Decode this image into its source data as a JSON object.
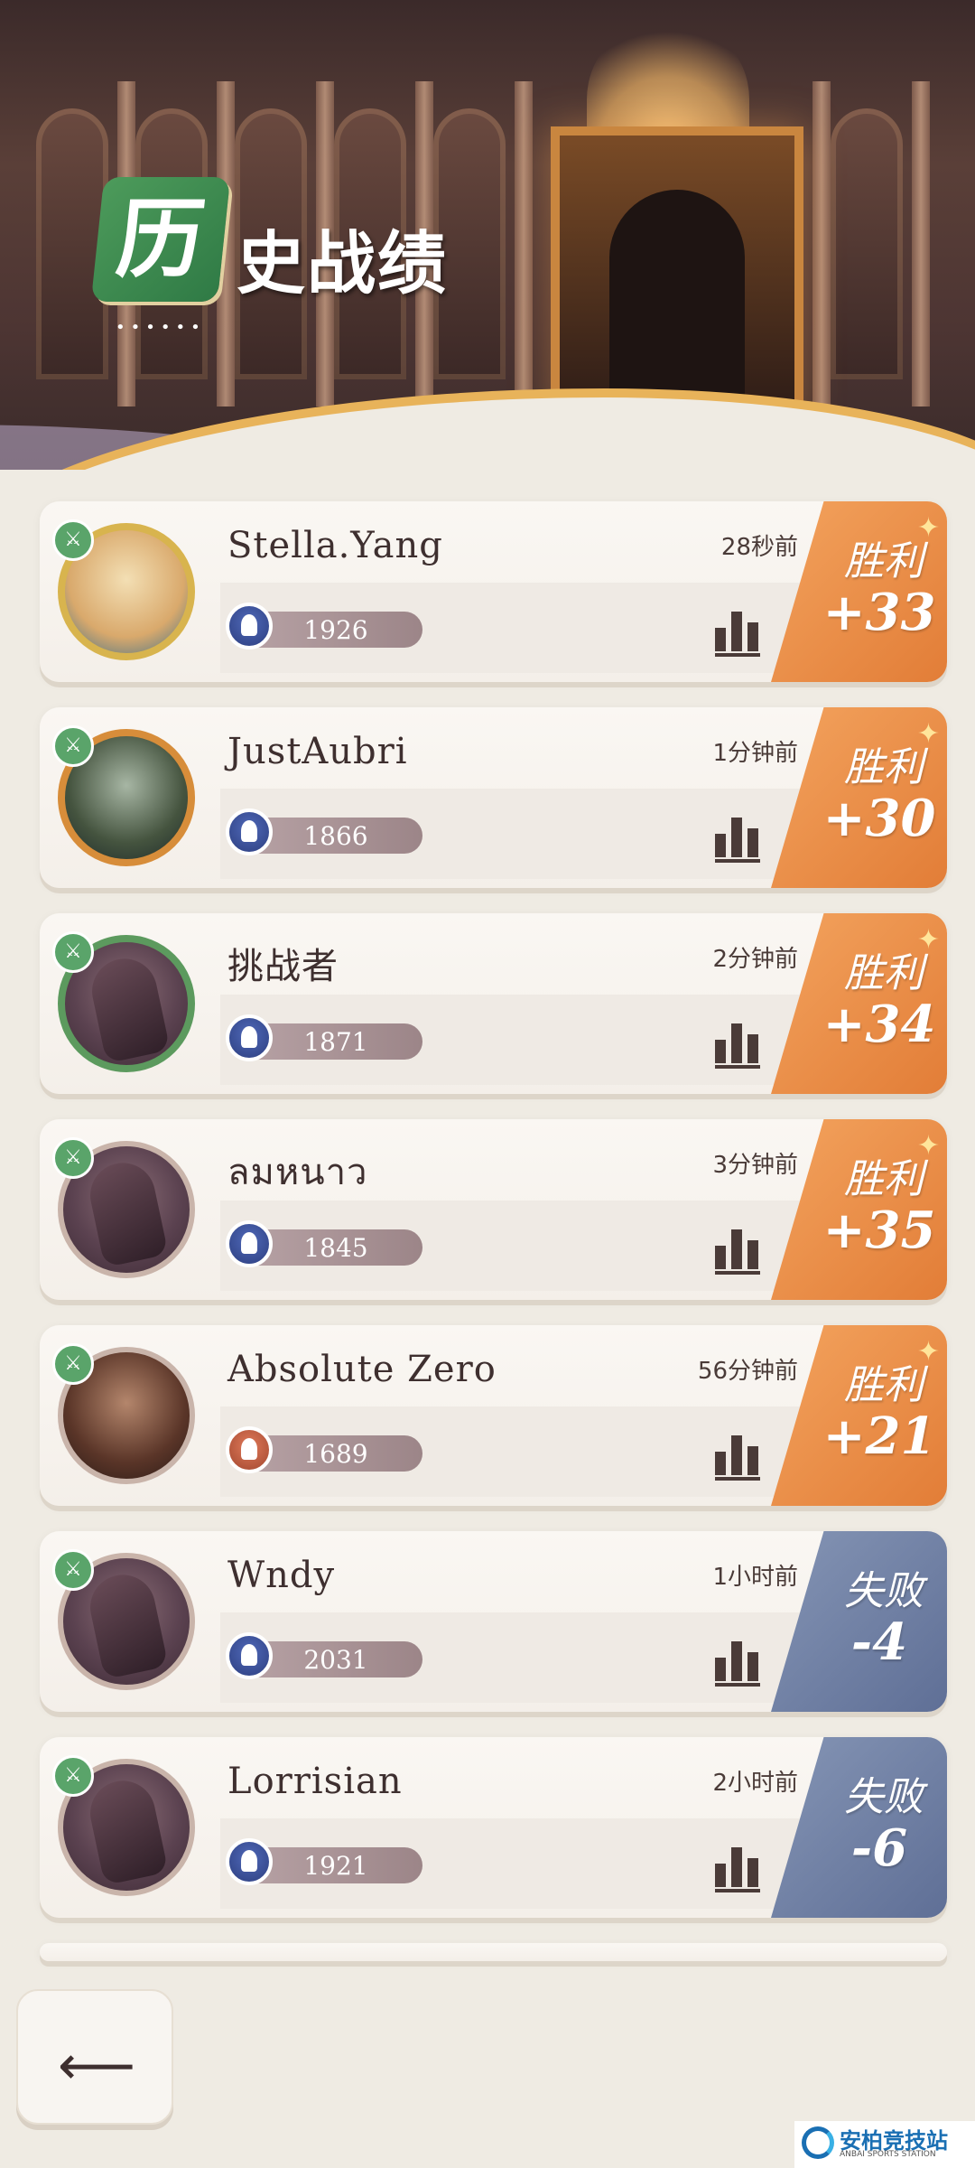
{
  "header": {
    "title_first_char": "历",
    "title_rest": "史战绩",
    "dots": "••••••"
  },
  "matches": [
    {
      "name": "Stella.Yang",
      "time": "28秒前",
      "score": "1926",
      "result": "胜利",
      "delta": "+33",
      "outcome": "win",
      "avatar": "gold",
      "emblem": "blue"
    },
    {
      "name": "JustAubri",
      "time": "1分钟前",
      "score": "1866",
      "result": "胜利",
      "delta": "+30",
      "outcome": "win",
      "avatar": "orange",
      "emblem": "blue"
    },
    {
      "name": "挑战者",
      "time": "2分钟前",
      "score": "1871",
      "result": "胜利",
      "delta": "+34",
      "outcome": "win",
      "avatar": "vine",
      "emblem": "blue"
    },
    {
      "name": "ลมหนาว",
      "time": "3分钟前",
      "score": "1845",
      "result": "胜利",
      "delta": "+35",
      "outcome": "win",
      "avatar": "hood",
      "emblem": "blue"
    },
    {
      "name": "Absolute Zero",
      "time": "56分钟前",
      "score": "1689",
      "result": "胜利",
      "delta": "+21",
      "outcome": "win",
      "avatar": "dark",
      "emblem": "red"
    },
    {
      "name": "Wndy",
      "time": "1小时前",
      "score": "2031",
      "result": "失败",
      "delta": "-4",
      "outcome": "loss",
      "avatar": "hood",
      "emblem": "blue"
    },
    {
      "name": "Lorrisian",
      "time": "2小时前",
      "score": "1921",
      "result": "失败",
      "delta": "-6",
      "outcome": "loss",
      "avatar": "hood",
      "emblem": "blue"
    }
  ],
  "back_button": {
    "icon": "back-arrow-icon",
    "glyph": "⟵"
  },
  "watermark": {
    "title": "安柏竞技站",
    "subtitle": "ANBAI SPORTS STATION"
  },
  "colors": {
    "win": "#e88a40",
    "loss": "#6e7ea3",
    "rank_badge": "#5aa46a"
  }
}
